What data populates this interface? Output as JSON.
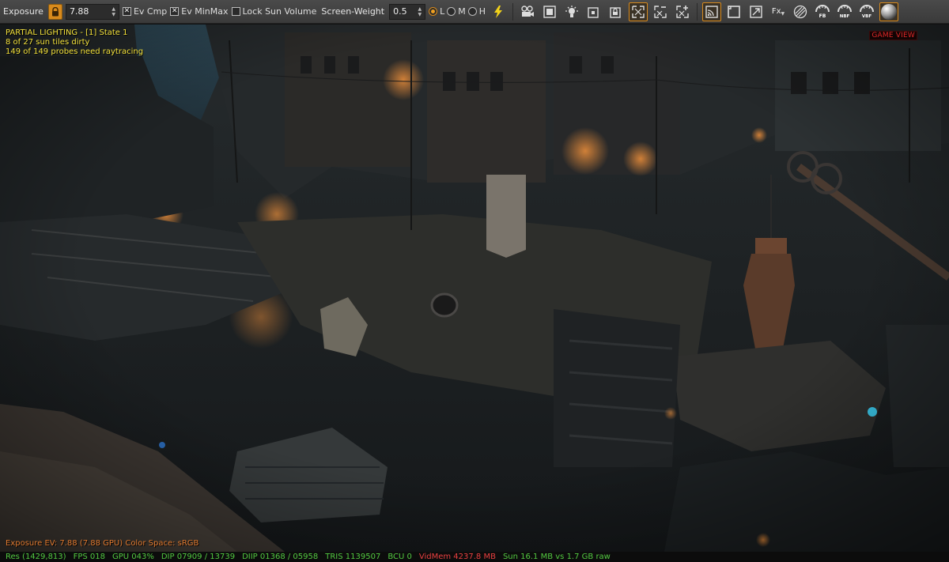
{
  "toolbar": {
    "exposure_label": "Exposure",
    "exposure_value": "7.88",
    "ev_cmp_label": "Ev Cmp",
    "ev_cmp_checked": true,
    "ev_minmax_label": "Ev MinMax",
    "ev_minmax_checked": true,
    "lock_sun_label": "Lock Sun Volume",
    "lock_sun_checked": false,
    "screen_weight_label": "Screen-Weight",
    "screen_weight_value": "0.5",
    "quality_options": [
      "L",
      "M",
      "H"
    ],
    "quality_selected": "L",
    "fx_label": "Fx",
    "fb_label": "FB",
    "nbf_label": "NBF",
    "vbf_label": "VBF",
    "accent_color": "#d88a1c"
  },
  "overlay": {
    "title": "PARTIAL LIGHTING - [1] State 1",
    "line2": "8 of 27 sun tiles dirty",
    "line3": "149 of 149 probes need raytracing",
    "game_view": "GAME VIEW",
    "exposure_info": "Exposure EV: 7.88 (7.88 GPU)   Color Space: sRGB"
  },
  "status": {
    "res": "Res (1429,813)",
    "fps": "FPS 018",
    "gpu": "GPU 043%",
    "dip": "DIP 07909 / 13739",
    "diip": "DIIP 01368 / 05958",
    "tris": "TRIS 1139507",
    "bcu": "BCU 0",
    "vidmem": "VidMem 4237.8 MB",
    "sun": "Sun 16.1 MB vs 1.7 GB raw"
  }
}
